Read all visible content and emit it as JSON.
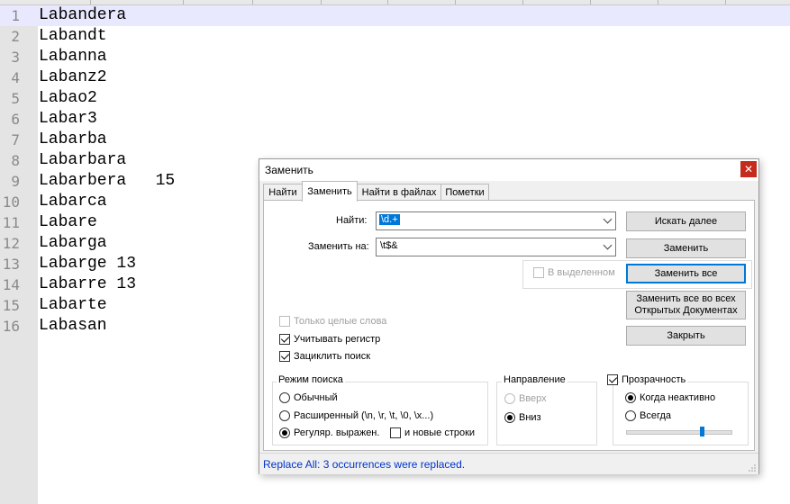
{
  "editor": {
    "current_line": 1,
    "lines": [
      {
        "num": "1",
        "text": "Labandera"
      },
      {
        "num": "2",
        "text": "Labandt"
      },
      {
        "num": "3",
        "text": "Labanna"
      },
      {
        "num": "4",
        "text": "Labanz2"
      },
      {
        "num": "5",
        "text": "Labao2"
      },
      {
        "num": "6",
        "text": "Labar3"
      },
      {
        "num": "7",
        "text": "Labarba"
      },
      {
        "num": "8",
        "text": "Labarbara"
      },
      {
        "num": "9",
        "text": "Labarbera   15"
      },
      {
        "num": "10",
        "text": "Labarca"
      },
      {
        "num": "11",
        "text": "Labare"
      },
      {
        "num": "12",
        "text": "Labarga"
      },
      {
        "num": "13",
        "text": "Labarge 13"
      },
      {
        "num": "14",
        "text": "Labarre 13"
      },
      {
        "num": "15",
        "text": "Labarte"
      },
      {
        "num": "16",
        "text": "Labasan"
      }
    ]
  },
  "dialog": {
    "title": "Заменить",
    "close_icon": "close-icon",
    "tabs": [
      {
        "label": "Найти",
        "active": false
      },
      {
        "label": "Заменить",
        "active": true
      },
      {
        "label": "Найти в файлах",
        "active": false
      },
      {
        "label": "Пометки",
        "active": false
      }
    ],
    "find_label": "Найти:",
    "find_value": "\\d.+",
    "replace_label": "Заменить на:",
    "replace_value": "\\t$&",
    "in_selection_label": "В выделенном",
    "buttons": {
      "find_next": "Искать далее",
      "replace": "Заменить",
      "replace_all": "Заменить все",
      "replace_all_open_line1": "Заменить все во всех",
      "replace_all_open_line2": "Открытых Документах",
      "close": "Закрыть"
    },
    "options": {
      "whole_word": {
        "label": "Только целые слова",
        "checked": false,
        "enabled": false
      },
      "match_case": {
        "label": "Учитывать регистр",
        "checked": true
      },
      "wrap_around": {
        "label": "Зациклить поиск",
        "checked": true
      }
    },
    "search_mode": {
      "title": "Режим поиска",
      "normal": "Обычный",
      "extended": "Расширенный (\\n, \\r, \\t, \\0, \\x...)",
      "regex": "Регуляр. выражен.",
      "dot_newline": "и новые строки",
      "selected": "regex"
    },
    "direction": {
      "title": "Направление",
      "up": "Вверх",
      "down": "Вниз",
      "selected": "down"
    },
    "transparency": {
      "title": "Прозрачность",
      "enabled": true,
      "on_lose_focus": "Когда неактивно",
      "always": "Всегда",
      "selected": "on_lose_focus",
      "level": 0.72
    },
    "status": "Replace All: 3 occurrences were replaced."
  },
  "colors": {
    "accent": "#0078d7",
    "current_line": "#e8e8ff",
    "status_text": "#0033cc"
  }
}
